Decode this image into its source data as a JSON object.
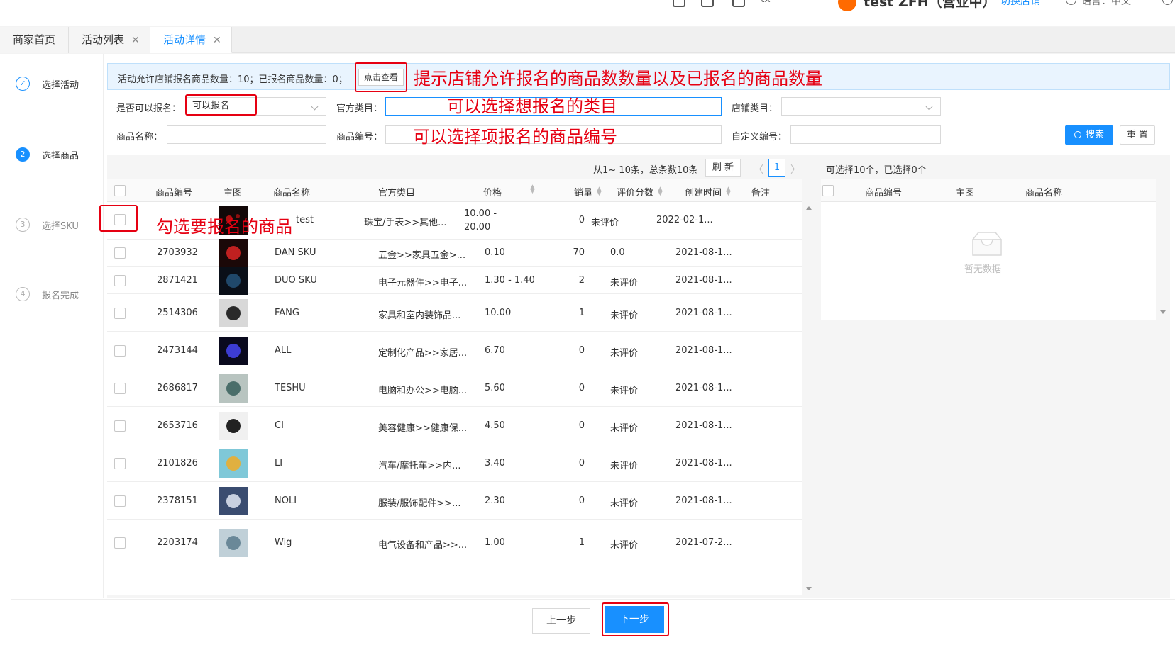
{
  "header": {
    "partial_text": "tx",
    "shop_name": "test ZFH（营业中）",
    "switch_shop": "切换店铺",
    "language": "语言：中文"
  },
  "tabs": [
    {
      "label": "商家首页",
      "closable": false,
      "active": false
    },
    {
      "label": "活动列表",
      "closable": true,
      "active": false
    },
    {
      "label": "活动详情",
      "closable": true,
      "active": true
    }
  ],
  "close_glyph": "✕",
  "steps": [
    {
      "num": "✓",
      "label": "选择活动",
      "state": "done"
    },
    {
      "num": "2",
      "label": "选择商品",
      "state": "active"
    },
    {
      "num": "3",
      "label": "选择SKU",
      "state": "pending"
    },
    {
      "num": "4",
      "label": "报名完成",
      "state": "pending"
    }
  ],
  "notice": {
    "text": "活动允许店铺报名商品数量：10；已报名商品数量：0；",
    "button": "点击查看"
  },
  "filters": {
    "can_enroll_label": "是否可以报名：",
    "can_enroll_value": "可以报名",
    "official_category_label": "官方类目：",
    "shop_category_label": "店铺类目：",
    "product_name_label": "商品名称：",
    "product_code_label": "商品编号：",
    "custom_code_label": "自定义编号：",
    "search_button": "搜索",
    "reset_button": "重 置"
  },
  "pager": {
    "summary": "从1~ 10条，总条数10条",
    "refresh": "刷 新",
    "prev": "〈",
    "page": "1",
    "next": "〉",
    "selection": "可选择10个，已选择0个"
  },
  "left_table": {
    "headers": {
      "code": "商品编号",
      "image": "主图",
      "name": "商品名称",
      "category": "官方类目",
      "price": "价格",
      "sales": "销量",
      "rating": "评价分数",
      "created": "创建时间",
      "remark": "备注"
    },
    "rows": [
      {
        "code": "2703932",
        "name": "DAN SKU",
        "category": "五金>>家具五金>...",
        "price": "0.10",
        "sales": "70",
        "rating": "0.0",
        "created": "2021-08-1..."
      },
      {
        "code": "2871421",
        "name": "DUO SKU",
        "category": "电子元器件>>电子...",
        "price": "1.30 - 1.40",
        "sales": "2",
        "rating": "未评价",
        "created": "2021-08-1..."
      },
      {
        "code": "2514306",
        "name": "FANG",
        "category": "家具和室内装饰品...",
        "price": "10.00",
        "sales": "1",
        "rating": "未评价",
        "created": "2021-08-1..."
      },
      {
        "code": "2473144",
        "name": "ALL",
        "category": "定制化产品>>家居...",
        "price": "6.70",
        "sales": "0",
        "rating": "未评价",
        "created": "2021-08-1..."
      },
      {
        "code": "2686817",
        "name": "TESHU",
        "category": "电脑和办公>>电脑...",
        "price": "5.60",
        "sales": "0",
        "rating": "未评价",
        "created": "2021-08-1..."
      },
      {
        "code": "2653716",
        "name": "CI",
        "category": "美容健康>>健康保...",
        "price": "4.50",
        "sales": "0",
        "rating": "未评价",
        "created": "2021-08-1..."
      },
      {
        "code": "2101826",
        "name": "LI",
        "category": "汽车/摩托车>>内...",
        "price": "3.40",
        "sales": "0",
        "rating": "未评价",
        "created": "2021-08-1..."
      },
      {
        "code": "2378151",
        "name": "NOLI",
        "category": "服装/服饰配件>>...",
        "price": "2.30",
        "sales": "0",
        "rating": "未评价",
        "created": "2021-08-1..."
      },
      {
        "code": "2203174",
        "name": "Wig",
        "category": "电气设备和产品>>...",
        "price": "1.00",
        "sales": "1",
        "rating": "未评价",
        "created": "2021-07-2..."
      }
    ],
    "first_row": {
      "name_tail": "test",
      "category": "珠宝/手表>>其他...",
      "price_line1": "10.00 -",
      "price_line2": "20.00",
      "sales": "0",
      "rating": "未评价",
      "created": "2022-02-1..."
    }
  },
  "right_table": {
    "headers": {
      "code": "商品编号",
      "image": "主图",
      "name": "商品名称"
    },
    "empty_text": "暂无数据"
  },
  "footer": {
    "prev_button": "上一步",
    "next_button": "下一步"
  },
  "annotations": {
    "notice_hint": "提示店铺允许报名的商品数数量以及已报名的商品数量",
    "category_hint": "可以选择想报名的类目",
    "code_hint": "可以选择项报名的商品编号",
    "select_hint": "勾选要报名的商品"
  },
  "colors": {
    "primary": "#1890ff",
    "annotation": "#e60012",
    "notice_bg": "#e9f4fe"
  }
}
